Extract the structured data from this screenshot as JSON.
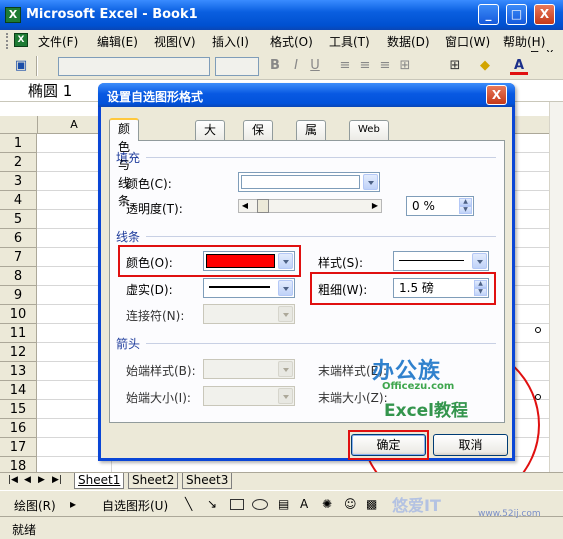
{
  "window": {
    "title": "Microsoft Excel - Book1",
    "buttons": [
      "_",
      "□",
      "X"
    ]
  },
  "menu": {
    "items": [
      "文件(F)",
      "编辑(E)",
      "视图(V)",
      "插入(I)",
      "格式(O)",
      "工具(T)",
      "数据(D)",
      "窗口(W)",
      "帮助(H)"
    ],
    "mdi_buttons": [
      "_",
      "⊡",
      "X"
    ]
  },
  "namebox": {
    "value": "椭圆 1"
  },
  "sheet": {
    "column_header": "A",
    "rows": [
      "1",
      "2",
      "3",
      "4",
      "5",
      "6",
      "7",
      "8",
      "9",
      "10",
      "11",
      "12",
      "13",
      "14",
      "15",
      "16",
      "17",
      "18"
    ],
    "tabs": [
      "Sheet1",
      "Sheet2",
      "Sheet3"
    ],
    "shape_color": "#E01010"
  },
  "drawing_toolbar": {
    "draw_label": "绘图(R)",
    "autoshapes_label": "自选图形(U)"
  },
  "status": {
    "text": "就绪"
  },
  "dialog": {
    "title": "设置自选图形格式",
    "tabs": [
      "颜色与线条",
      "大小",
      "保护",
      "属性",
      "Web"
    ],
    "fill": {
      "section": "填充",
      "color_label": "颜色(C):",
      "transparency_label": "透明度(T):",
      "transparency_value": "0 %",
      "color": "#FFFFFF"
    },
    "line": {
      "section": "线条",
      "color_label": "颜色(O):",
      "color": "#FF0000",
      "style_label": "样式(S):",
      "dash_label": "虚实(D):",
      "weight_label": "粗细(W):",
      "weight_value": "1.5 磅",
      "connector_label": "连接符(N):"
    },
    "arrows": {
      "section": "箭头",
      "begin_style_label": "始端样式(B):",
      "end_style_label": "末端样式(E):",
      "begin_size_label": "始端大小(I):",
      "end_size_label": "末端大小(Z):"
    },
    "ok_label": "确定",
    "cancel_label": "取消",
    "highlight_color": "#E01010"
  },
  "watermark": {
    "line1": "办公族",
    "line2": "Officezu.com",
    "line3": "Excel教程",
    "corner": "悠爱IT",
    "corner_url": "www.52ij.com"
  }
}
